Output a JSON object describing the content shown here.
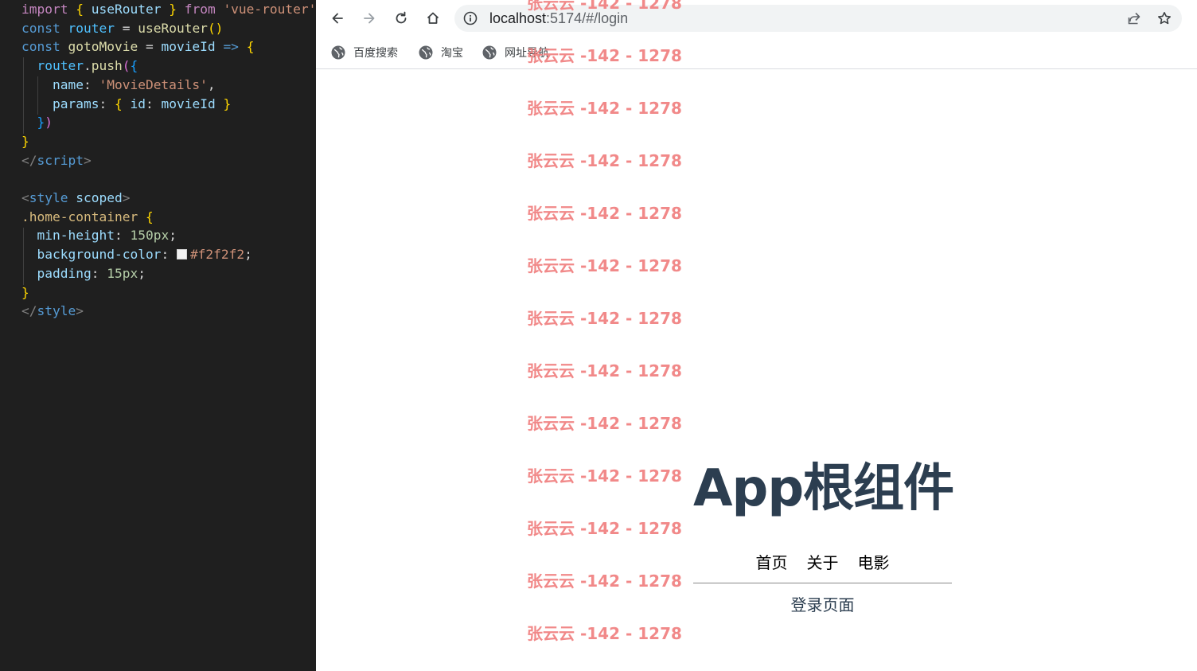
{
  "editor": {
    "lines": [
      {
        "tokens": [
          [
            "k-kw",
            "import"
          ],
          [
            "k-txt",
            " "
          ],
          [
            "k-br1",
            "{"
          ],
          [
            "k-txt",
            " "
          ],
          [
            "k-prop",
            "useRouter"
          ],
          [
            "k-txt",
            " "
          ],
          [
            "k-br1",
            "}"
          ],
          [
            "k-txt",
            " "
          ],
          [
            "k-kw",
            "from"
          ],
          [
            "k-txt",
            " "
          ],
          [
            "k-str",
            "'vue-router'"
          ]
        ]
      },
      {
        "tokens": [
          [
            "k-st",
            "const"
          ],
          [
            "k-txt",
            " "
          ],
          [
            "k-var",
            "router"
          ],
          [
            "k-txt",
            " = "
          ],
          [
            "k-fn",
            "useRouter"
          ],
          [
            "k-br1",
            "()"
          ]
        ]
      },
      {
        "tokens": [
          [
            "k-st",
            "const"
          ],
          [
            "k-txt",
            " "
          ],
          [
            "k-fn",
            "gotoMovie"
          ],
          [
            "k-txt",
            " = "
          ],
          [
            "k-prop",
            "movieId"
          ],
          [
            "k-txt",
            " "
          ],
          [
            "k-st",
            "=>"
          ],
          [
            "k-txt",
            " "
          ],
          [
            "k-br1",
            "{"
          ]
        ]
      },
      {
        "tokens": [
          [
            "k-txt",
            "  "
          ],
          [
            "k-var",
            "router"
          ],
          [
            "k-txt",
            "."
          ],
          [
            "k-fn",
            "push"
          ],
          [
            "k-br2",
            "("
          ],
          [
            "k-br3",
            "{"
          ]
        ]
      },
      {
        "tokens": [
          [
            "k-txt",
            "    "
          ],
          [
            "k-prop",
            "name"
          ],
          [
            "k-txt",
            ": "
          ],
          [
            "k-str",
            "'MovieDetails'"
          ],
          [
            "k-txt",
            ","
          ]
        ]
      },
      {
        "tokens": [
          [
            "k-txt",
            "    "
          ],
          [
            "k-prop",
            "params"
          ],
          [
            "k-txt",
            ": "
          ],
          [
            "k-br1",
            "{"
          ],
          [
            "k-txt",
            " "
          ],
          [
            "k-prop",
            "id"
          ],
          [
            "k-txt",
            ": "
          ],
          [
            "k-prop",
            "movieId"
          ],
          [
            "k-txt",
            " "
          ],
          [
            "k-br1",
            "}"
          ]
        ]
      },
      {
        "tokens": [
          [
            "k-txt",
            "  "
          ],
          [
            "k-br3",
            "}"
          ],
          [
            "k-br2",
            ")"
          ]
        ]
      },
      {
        "tokens": [
          [
            "k-br1",
            "}"
          ]
        ]
      },
      {
        "tokens": [
          [
            "k-ang",
            "</"
          ],
          [
            "k-tag",
            "script"
          ],
          [
            "k-ang",
            ">"
          ]
        ]
      },
      {
        "tokens": []
      },
      {
        "tokens": [
          [
            "k-ang",
            "<"
          ],
          [
            "k-tag",
            "style"
          ],
          [
            "k-txt",
            " "
          ],
          [
            "k-prop",
            "scoped"
          ],
          [
            "k-ang",
            ">"
          ]
        ]
      },
      {
        "tokens": [
          [
            "k-sel",
            ".home-container"
          ],
          [
            "k-txt",
            " "
          ],
          [
            "k-br1",
            "{"
          ]
        ]
      },
      {
        "tokens": [
          [
            "k-txt",
            "  "
          ],
          [
            "k-prop",
            "min-height"
          ],
          [
            "k-txt",
            ": "
          ],
          [
            "k-num",
            "150px"
          ],
          [
            "k-txt",
            ";"
          ]
        ]
      },
      {
        "tokens": [
          [
            "k-txt",
            "  "
          ],
          [
            "k-prop",
            "background-color"
          ],
          [
            "k-txt",
            ": "
          ],
          [
            "swatch",
            ""
          ],
          [
            "k-str",
            "#f2f2f2"
          ],
          [
            "k-txt",
            ";"
          ]
        ]
      },
      {
        "tokens": [
          [
            "k-txt",
            "  "
          ],
          [
            "k-prop",
            "padding"
          ],
          [
            "k-txt",
            ": "
          ],
          [
            "k-num",
            "15px"
          ],
          [
            "k-txt",
            ";"
          ]
        ]
      },
      {
        "tokens": [
          [
            "k-br1",
            "}"
          ]
        ]
      },
      {
        "tokens": [
          [
            "k-ang",
            "</"
          ],
          [
            "k-tag",
            "style"
          ],
          [
            "k-ang",
            ">"
          ]
        ]
      }
    ]
  },
  "browser": {
    "url_host": "localhost",
    "url_rest": ":5174/#/login",
    "bookmarks": [
      "百度搜索",
      "淘宝",
      "网址导航"
    ]
  },
  "page": {
    "title": "App根组件",
    "nav": [
      "首页",
      "关于",
      "电影"
    ],
    "subtitle": "登录页面"
  },
  "watermark": {
    "text": "张云云 -142 - 1278",
    "count": 13
  },
  "colors": {
    "editor_bg": "#1f1f1f",
    "title": "#2c3e50",
    "watermark": "#f08080"
  }
}
